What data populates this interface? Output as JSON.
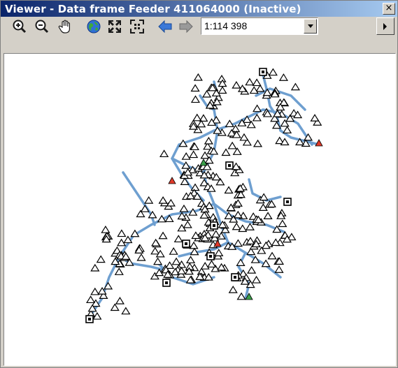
{
  "window": {
    "title": "Viewer - Data frame Feeder 411064000 (Inactive)",
    "close_glyph": "×"
  },
  "toolbar": {
    "tools": [
      {
        "name": "zoom-in-icon"
      },
      {
        "name": "zoom-out-icon"
      },
      {
        "name": "pan-hand-icon"
      },
      {
        "name": "full-extent-globe-icon"
      },
      {
        "name": "fixed-zoom-in-icon"
      },
      {
        "name": "fixed-zoom-out-icon"
      },
      {
        "name": "back-arrow-icon"
      },
      {
        "name": "forward-arrow-icon"
      }
    ],
    "scale": {
      "value": "1:114 398"
    }
  },
  "map": {
    "line_color": "#6e9fd0",
    "symbol_color": "#000000",
    "highlight_colors": [
      "#e03a2a",
      "#3aa04a"
    ]
  }
}
